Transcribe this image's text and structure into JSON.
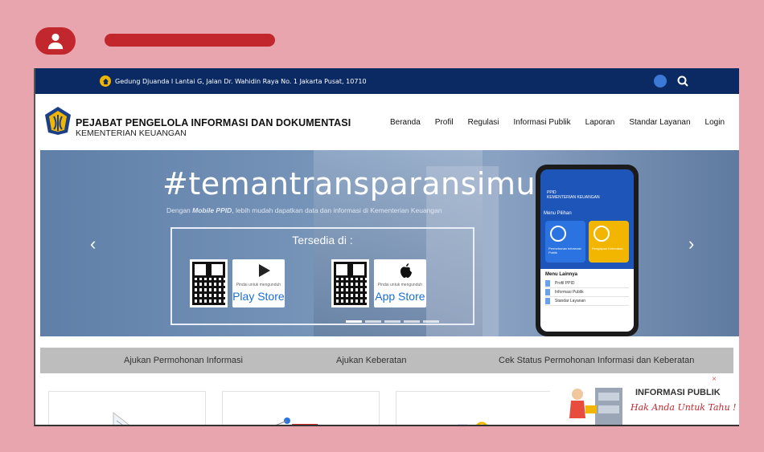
{
  "topbar": {
    "address": "Gedung Djuanda I Lantai G, Jalan Dr. Wahidin Raya No. 1 Jakarta Pusat, 10710"
  },
  "header": {
    "title": "PEJABAT PENGELOLA INFORMASI DAN DOKUMENTASI",
    "subtitle": "KEMENTERIAN KEUANGAN",
    "nav": [
      "Beranda",
      "Profil",
      "Regulasi",
      "Informasi Publik",
      "Laporan",
      "Standar Layanan",
      "Login"
    ]
  },
  "hero": {
    "hashtag": "#temantransparansimu",
    "tagline_prefix": "Dengan ",
    "tagline_bold": "Mobile PPID",
    "tagline_suffix": ", lebih mudah dapatkan data dan informasi di Kementerian Keuangan",
    "available_title": "Tersedia di :",
    "stores": [
      {
        "small": "Pindai untuk mengunduh",
        "name": "Play Store"
      },
      {
        "small": "Pindai untuk mengunduh",
        "name": "App Store"
      }
    ],
    "arrow_left": "‹",
    "arrow_right": "›",
    "phone": {
      "header_line1": "PPID",
      "header_line2": "KEMENTERIAN KEUANGAN",
      "menu_title": "Menu Pilihan",
      "tile1": "Permohonan Informasi Publik",
      "tile2": "Pengajuan Keberatan",
      "other_title": "Menu Lainnya",
      "other_items": [
        "Profil PPID",
        "Informasi Publik",
        "Standar Layanan"
      ]
    }
  },
  "actions": [
    "Ajukan Permohonan Informasi",
    "Ajukan Keberatan",
    "Cek Status Permohonan Informasi dan Keberatan"
  ],
  "promo": {
    "close": "×",
    "line1": "INFORMASI PUBLIK",
    "line2": "Hak Anda Untuk Tahu !"
  },
  "colors": {
    "background": "#e8a5ad",
    "accent": "#c1272d",
    "topbar": "#0b2a63"
  }
}
